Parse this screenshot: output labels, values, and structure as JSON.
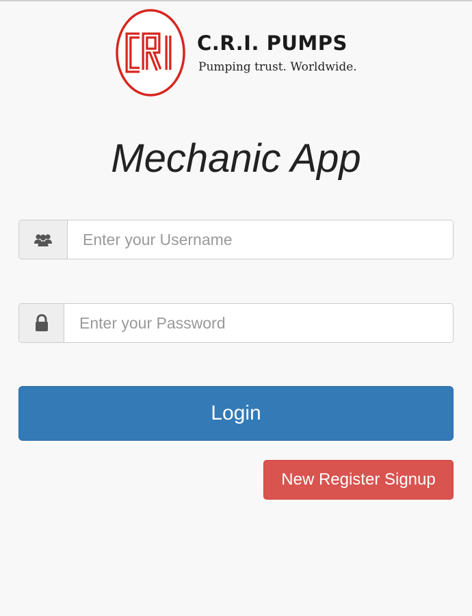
{
  "brand": {
    "logo_mark_text": "CRI",
    "name": "C.R.I. PUMPS",
    "tagline": "Pumping trust. Worldwide.",
    "logo_color": "#d7261e"
  },
  "app": {
    "title": "Mechanic App"
  },
  "form": {
    "username": {
      "icon": "users-icon",
      "placeholder": "Enter your Username",
      "value": ""
    },
    "password": {
      "icon": "lock-icon",
      "placeholder": "Enter your Password",
      "value": ""
    },
    "login_label": "Login",
    "signup_label": "New Register Signup"
  },
  "colors": {
    "primary": "#337ab7",
    "danger": "#d9534f",
    "background": "#f8f8f8"
  }
}
